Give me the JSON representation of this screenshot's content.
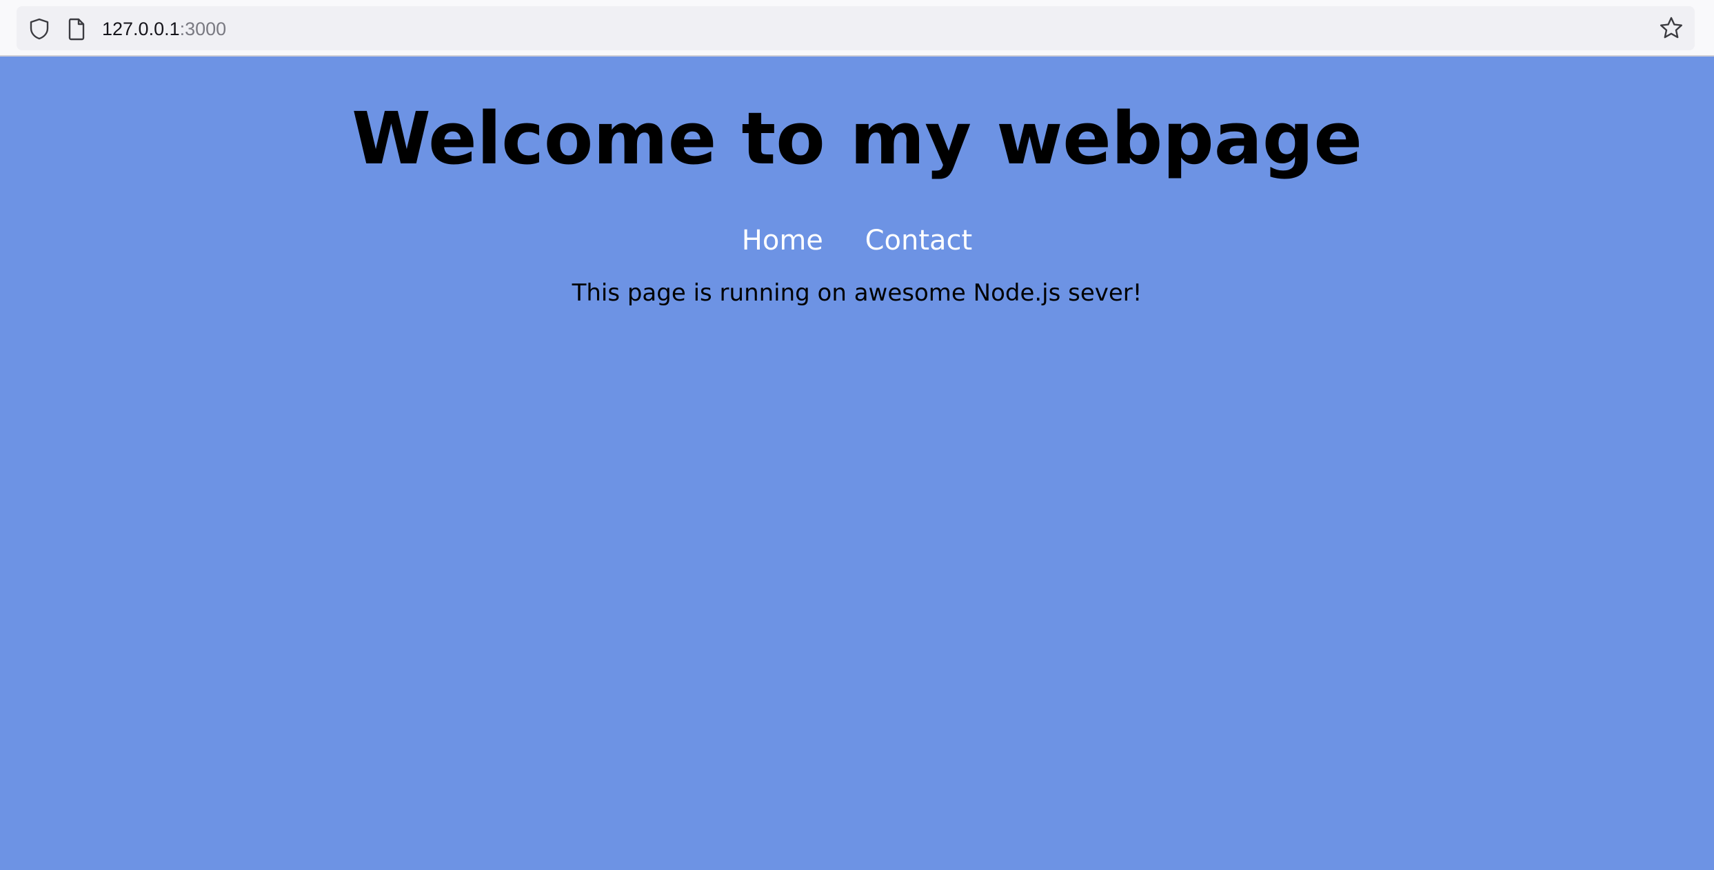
{
  "browser": {
    "url_host": "127.0.0.1",
    "url_port": ":3000"
  },
  "page": {
    "title": "Welcome to my webpage",
    "nav": {
      "home_label": "Home",
      "contact_label": "Contact"
    },
    "tagline": "This page is running on awesome Node.js sever!",
    "background_color": "#6d93e4"
  }
}
